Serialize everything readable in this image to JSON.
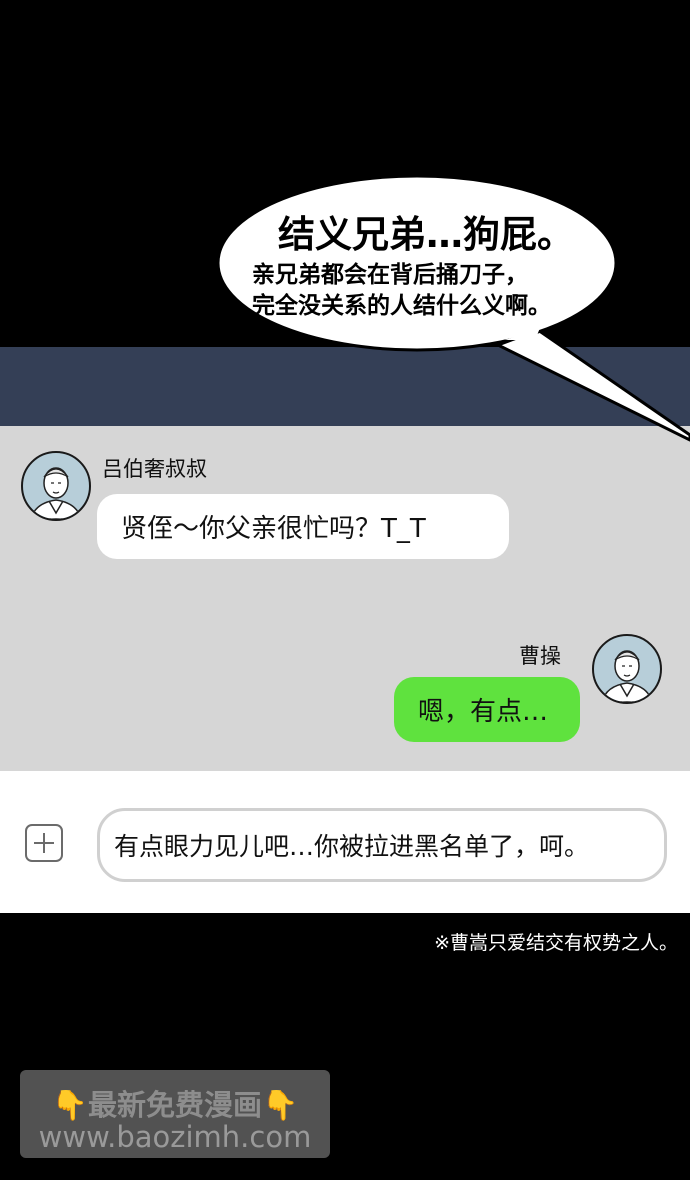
{
  "speech_bubble": {
    "title": "结义兄弟…狗屁。",
    "line1": "亲兄弟都会在背后捅刀子，",
    "line2": "完全没关系的人结什么义啊。"
  },
  "chat": {
    "incoming": {
      "sender": "吕伯奢叔叔",
      "text": "贤侄～你父亲很忙吗？T_T"
    },
    "outgoing": {
      "sender": "曹操",
      "text": "嗯，有点…"
    }
  },
  "composer": {
    "text": "有点眼力见儿吧…你被拉进黑名单了，呵。"
  },
  "footnote": "※曹嵩只爱结交有权势之人。",
  "watermark": {
    "line1": "👇最新免费漫画👇",
    "line2": "www.baozimh.com"
  },
  "colors": {
    "navbar": "#343f56",
    "chat_bg": "#d6d6d6",
    "bubble_out": "#5fe23e",
    "bubble_in": "#ffffff",
    "avatar_bg": "#b7ced9"
  }
}
